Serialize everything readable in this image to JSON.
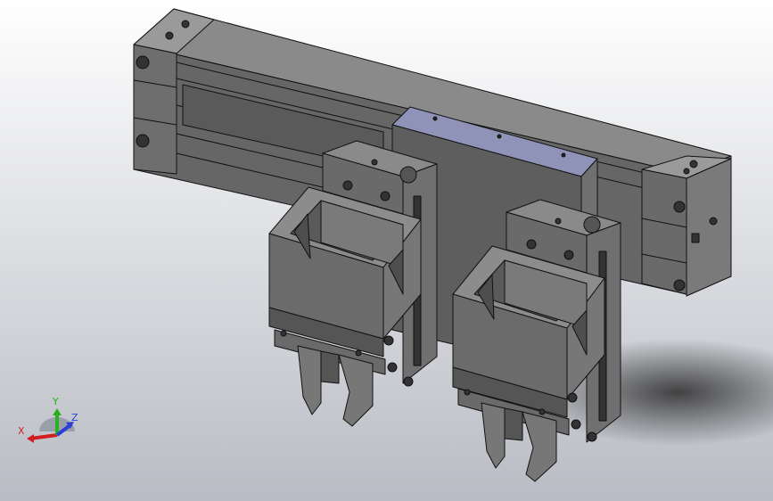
{
  "viewport": {
    "background_top": "#ffffff",
    "background_bottom": "#b9bcc4"
  },
  "model": {
    "body_color": "#6b6b6b",
    "body_dark": "#4a4a4a",
    "body_light": "#8a8a8a",
    "plate_color": "#8f93b8",
    "edge_color": "#111111"
  },
  "triad": {
    "x_label": "X",
    "y_label": "Y",
    "z_label": "Z",
    "x_color": "#d11f1f",
    "y_color": "#27b11e",
    "z_color": "#2b3fd6"
  }
}
